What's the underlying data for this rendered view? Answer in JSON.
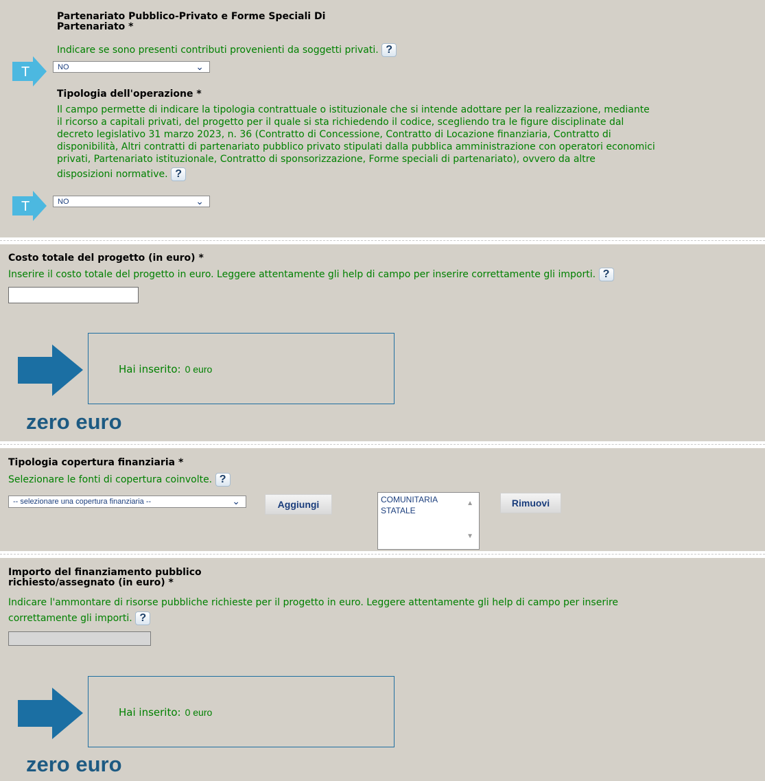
{
  "partenariato": {
    "label": "Partenariato Pubblico-Privato e Forme Speciali Di Partenariato *",
    "label_line1": "Partenariato Pubblico-Privato e Forme Speciali Di",
    "label_line2": "Partenariato *",
    "help": "Indicare se sono presenti contributi provenienti da soggetti privati.",
    "selected": "NO"
  },
  "tipologia_operazione": {
    "label": "Tipologia dell'operazione *",
    "help_lines": [
      "Il campo permette di indicare la tipologia contrattuale o istituzionale che si intende adottare per la realizzazione, mediante",
      "il ricorso a capitali privati, del progetto per il quale si sta richiedendo il codice, scegliendo tra le figure disciplinate dal",
      "decreto legislativo 31 marzo 2023, n. 36 (Contratto di Concessione, Contratto di Locazione finanziaria, Contratto di",
      "disponibilità, Altri contratti di partenariato pubblico privato stipulati dalla pubblica amministrazione con operatori economici",
      "privati, Partenariato istituzionale, Contratto di sponsorizzazione, Forme speciali di partenariato), ovvero da altre",
      "disposizioni normative."
    ],
    "selected": "NO"
  },
  "costo_totale": {
    "label": "Costo totale del progetto (in euro) *",
    "help": "Inserire il costo totale del progetto in euro. Leggere attentamente gli help di campo per inserire correttamente gli importi.",
    "value": "",
    "inserted_label": "Hai inserito:",
    "inserted_value": "0 euro",
    "in_words": "zero euro"
  },
  "copertura": {
    "label": "Tipologia copertura finanziaria *",
    "help": "Selezionare le fonti di copertura coinvolte.",
    "select_placeholder": "-- selezionare una copertura finanziaria --",
    "add_button": "Aggiungi",
    "remove_button": "Rimuovi",
    "selected_items": [
      "COMUNITARIA",
      "STATALE"
    ]
  },
  "finanziamento": {
    "label_line1": "Importo del finanziamento pubblico",
    "label_line2": "richiesto/assegnato (in euro) *",
    "help_line1": "Indicare l'ammontare di risorse pubbliche richieste per il progetto in euro. Leggere attentamente gli help di campo per inserire",
    "help_line2": "correttamente gli importi.",
    "value": "",
    "inserted_label": "Hai inserito:",
    "inserted_value": "0 euro",
    "in_words": "zero euro"
  },
  "icons": {
    "help": "?",
    "tooltip_marker": "T",
    "chevron": "⌄",
    "scroll_up": "▲",
    "scroll_down": "▼"
  },
  "colors": {
    "background": "#d4d0c8",
    "help_text": "#008000",
    "arrow": "#1b6fa3",
    "tarrow": "#4cb8e0",
    "zero_text": "#1d5a82"
  }
}
